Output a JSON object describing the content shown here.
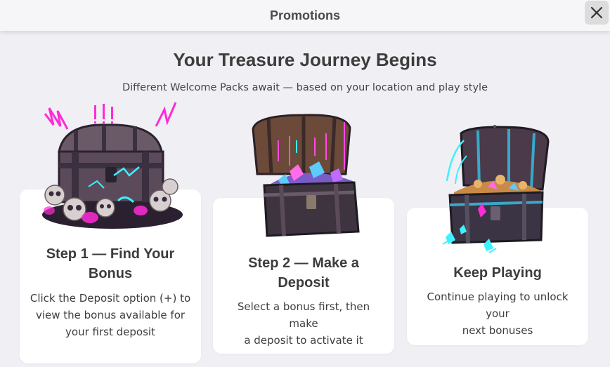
{
  "header": {
    "title": "Promotions",
    "close_icon": "close-icon"
  },
  "hero": {
    "title": "Your Treasure Journey Begins",
    "subtitle": "Different Welcome Packs await — based on your location and play style"
  },
  "steps": [
    {
      "title_line1": "Step 1 — Find Your",
      "title_line2": "Bonus",
      "text_line1": "Click the Deposit option (+) to",
      "text_line2": "view the bonus available for",
      "text_line3": "your first deposit",
      "illustration": "treasure-chest-skulls-icon"
    },
    {
      "title_line1": "Step 2 — Make a",
      "title_line2": "Deposit",
      "text_line1": "Select a bonus first, then make",
      "text_line2": "a deposit to activate it",
      "illustration": "open-treasure-chest-gems-icon"
    },
    {
      "title_line1": "Keep Playing",
      "text_line1": "Continue playing to unlock your",
      "text_line2": "next bonuses",
      "illustration": "open-treasure-chest-coins-icon"
    }
  ],
  "colors": {
    "background": "#f0f0f4",
    "card": "#ffffff",
    "neon_pink": "#ff2bd6",
    "neon_cyan": "#3ff0ff"
  }
}
